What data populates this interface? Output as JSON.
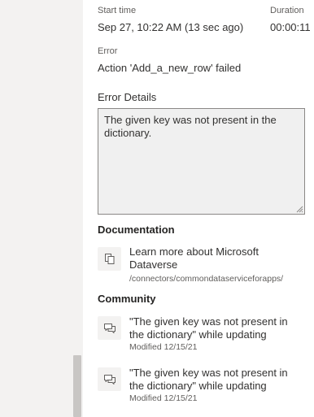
{
  "run": {
    "start_time_label": "Start time",
    "start_time_value": "Sep 27, 10:22 AM (13 sec ago)",
    "duration_label": "Duration",
    "duration_value": "00:00:11",
    "error_label": "Error",
    "error_value": "Action 'Add_a_new_row' failed"
  },
  "error_details": {
    "title": "Error Details",
    "message": "The given key was not present in the dictionary."
  },
  "documentation": {
    "title": "Documentation",
    "items": [
      {
        "title": "Learn more about Microsoft Dataverse",
        "subtitle": "/connectors/commondataserviceforapps/",
        "icon": "document-icon"
      }
    ]
  },
  "community": {
    "title": "Community",
    "items": [
      {
        "title": "\"The given key was not present in the dictionary\" while updating",
        "subtitle": "Modified 12/15/21",
        "icon": "chat-icon"
      },
      {
        "title": "\"The given key was not present in the dictionary\" while updating",
        "subtitle": "Modified 12/15/21",
        "icon": "chat-icon"
      }
    ]
  }
}
